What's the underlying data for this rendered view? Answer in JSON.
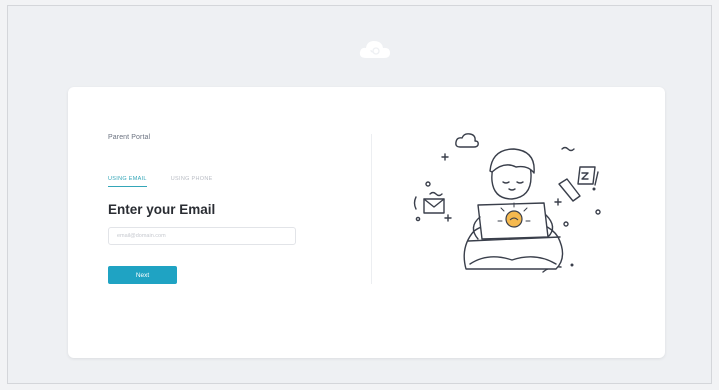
{
  "app": {
    "portal_title": "Parent Portal"
  },
  "tabs": [
    {
      "label": "USING EMAIL",
      "active": true
    },
    {
      "label": "USING PHONE",
      "active": false
    }
  ],
  "form": {
    "heading": "Enter your Email",
    "email_placeholder": "email@domain.com",
    "email_value": "",
    "submit_label": "Next"
  },
  "icons": {
    "logo": "cloud-logo-icon",
    "illustration": "person-with-laptop-illustration"
  },
  "colors": {
    "accent": "#1fa3c3",
    "tab_active": "#34a6b8",
    "heading": "#2a2d33",
    "page_bg": "#eef0f3"
  }
}
